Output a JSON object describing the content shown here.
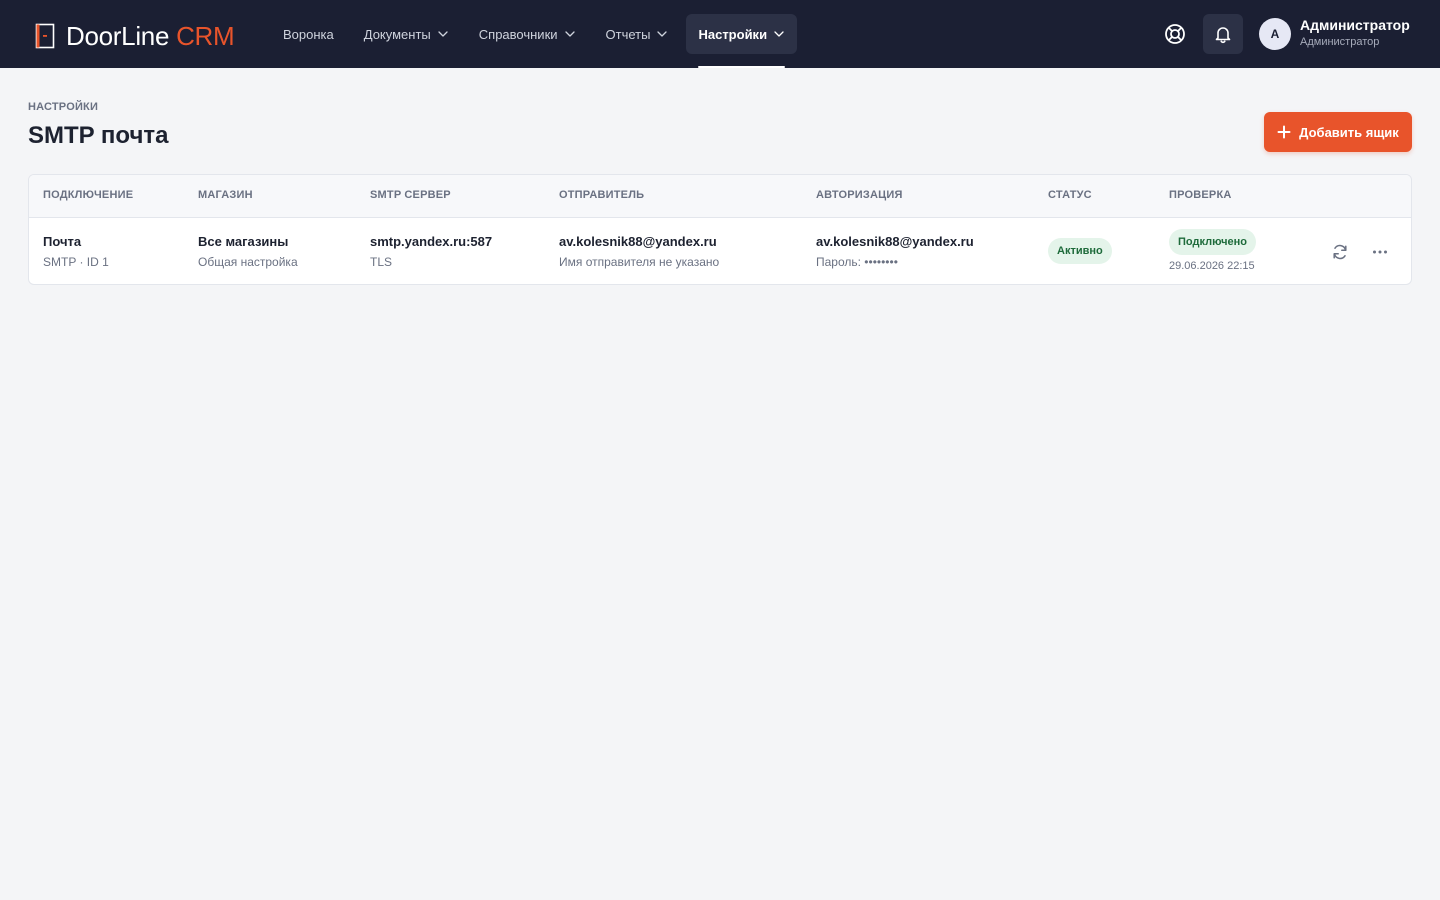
{
  "app": {
    "brand": "DoorLine",
    "brand_accent": "CRM",
    "accent_color": "#e8542b",
    "topbar_color": "#1b1f33"
  },
  "nav": {
    "items": [
      {
        "label": "Воронка",
        "has_dropdown": false,
        "active": false
      },
      {
        "label": "Документы",
        "has_dropdown": true,
        "active": false
      },
      {
        "label": "Справочники",
        "has_dropdown": true,
        "active": false
      },
      {
        "label": "Отчеты",
        "has_dropdown": true,
        "active": false
      },
      {
        "label": "Настройки",
        "has_dropdown": true,
        "active": true
      }
    ]
  },
  "topbar_actions": {
    "help_icon": "lifebuoy-icon",
    "notifications_icon": "bell-icon"
  },
  "user": {
    "avatar_letter": "A",
    "name": "Администратор",
    "role": "Администратор"
  },
  "page": {
    "breadcrumb": "НАСТРОЙКИ",
    "title": "SMTP почта",
    "add_button_label": "Добавить ящик"
  },
  "table": {
    "columns": [
      "ПОДКЛЮЧЕНИЕ",
      "МАГАЗИН",
      "SMTP СЕРВЕР",
      "ОТПРАВИТЕЛЬ",
      "АВТОРИЗАЦИЯ",
      "СТАТУС",
      "ПРОВЕРКА"
    ],
    "rows": [
      {
        "connection_name": "Почта",
        "connection_meta": "SMTP · ID 1",
        "store": "Все магазины",
        "store_note": "Общая настройка",
        "server": "smtp.yandex.ru:587",
        "encryption": "TLS",
        "sender": "av.kolesnik88@yandex.ru",
        "sender_name": "Имя отправителя не указано",
        "auth_login": "av.kolesnik88@yandex.ru",
        "auth_password": "Пароль: ••••••••",
        "status": "Активно",
        "check_status": "Подключено",
        "check_time": "29.06.2026 22:15"
      }
    ]
  }
}
